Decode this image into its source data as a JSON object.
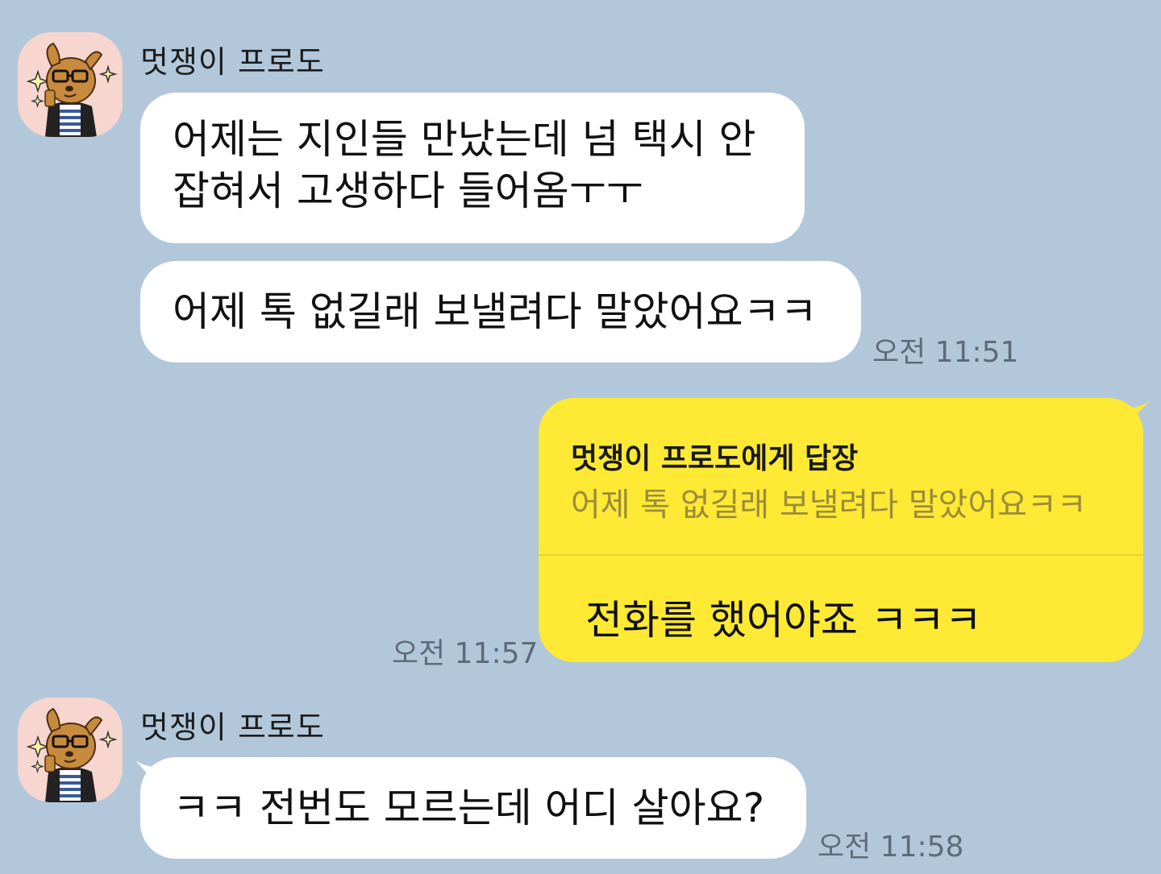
{
  "colors": {
    "background": "#b2c7da",
    "incoming_bubble": "#ffffff",
    "outgoing_bubble": "#fee934",
    "timestamp": "#5e6b78",
    "avatar_bg": "#f6d6cf"
  },
  "messages": [
    {
      "sender": "멋쟁이 프로도",
      "avatar_icon": "frodo-character-icon",
      "bubbles": [
        {
          "line1": "어제는 지인들 만났는데 넘 택시 안",
          "line2": "잡혀서 고생하다 들어옴ㅜㅜ"
        },
        {
          "text": "어제 톡 없길래 보낼려다 말았어요ㅋㅋ"
        }
      ],
      "time": "오전 11:51"
    },
    {
      "outgoing": true,
      "reply_header": "멋쟁이 프로도에게 답장",
      "reply_quote": "어제 톡 없길래 보낼려다 말았어요ㅋㅋ",
      "text": "전화를 했어야죠 ㅋㅋㅋ",
      "time": "오전 11:57"
    },
    {
      "sender": "멋쟁이 프로도",
      "avatar_icon": "frodo-character-icon",
      "text": "ㅋㅋ 전번도 모르는데 어디 살아요?",
      "time": "오전 11:58"
    }
  ]
}
